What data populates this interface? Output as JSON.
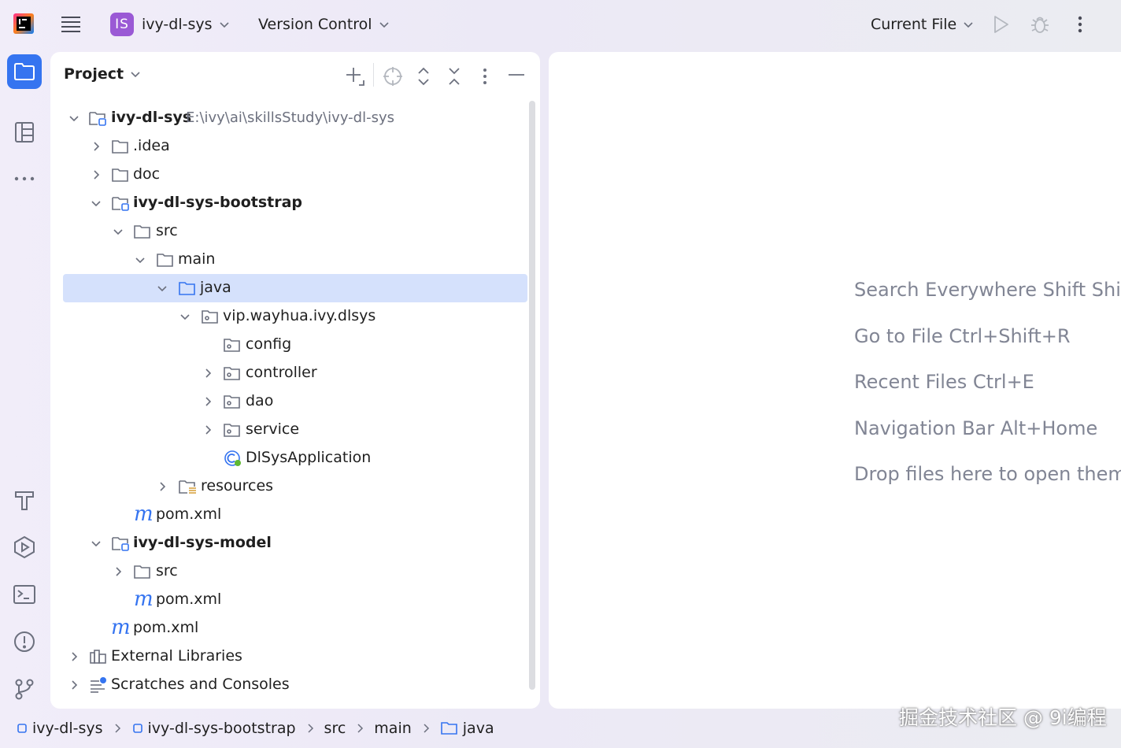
{
  "topbar": {
    "project_badge": "IS",
    "project_name": "ivy-dl-sys",
    "vcs_label": "Version Control",
    "run_config": "Current File"
  },
  "project_panel": {
    "title": "Project"
  },
  "tree": [
    {
      "label": "ivy-dl-sys",
      "path": "E:\\ivy\\ai\\skillsStudy\\ivy-dl-sys",
      "bold": true
    },
    {
      "label": ".idea"
    },
    {
      "label": "doc"
    },
    {
      "label": "ivy-dl-sys-bootstrap",
      "bold": true
    },
    {
      "label": "src"
    },
    {
      "label": "main"
    },
    {
      "label": "java",
      "selected": true
    },
    {
      "label": "vip.wayhua.ivy.dlsys"
    },
    {
      "label": "config"
    },
    {
      "label": "controller"
    },
    {
      "label": "dao"
    },
    {
      "label": "service"
    },
    {
      "label": "DlSysApplication"
    },
    {
      "label": "resources"
    },
    {
      "label": "pom.xml"
    },
    {
      "label": "ivy-dl-sys-model",
      "bold": true
    },
    {
      "label": "src"
    },
    {
      "label": "pom.xml"
    },
    {
      "label": "pom.xml"
    },
    {
      "label": "External Libraries"
    },
    {
      "label": "Scratches and Consoles"
    }
  ],
  "editor": {
    "hints": [
      "Search Everywhere Shift Shift",
      "Go to File Ctrl+Shift+R",
      "Recent Files Ctrl+E",
      "Navigation Bar Alt+Home",
      "Drop files here to open them"
    ]
  },
  "breadcrumb": [
    "ivy-dl-sys",
    "ivy-dl-sys-bootstrap",
    "src",
    "main",
    "java"
  ],
  "watermark": "掘金技术社区 @ 9i编程",
  "colors": {
    "accent": "#3574f0",
    "selection": "#d5e1fc",
    "project_badge": "#9a59d5",
    "hint_text": "#818594"
  }
}
